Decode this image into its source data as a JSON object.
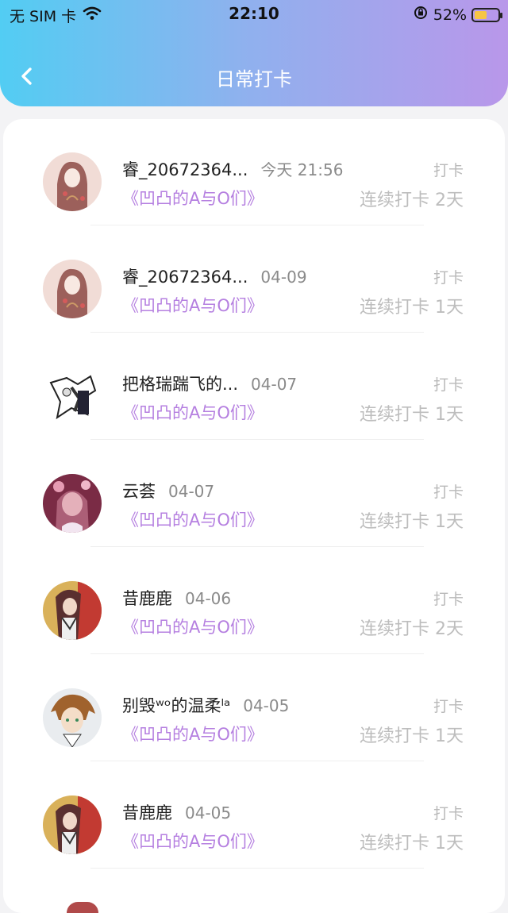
{
  "status_bar": {
    "carrier": "无 SIM 卡",
    "time": "22:10",
    "battery_percent": "52%",
    "battery_level": 0.52
  },
  "nav": {
    "title": "日常打卡",
    "back_icon": "chevron-left-icon"
  },
  "colors": {
    "header_gradient": [
      "#52cdf3",
      "#b997ea"
    ],
    "book_title": "#b57fe0",
    "muted": "#bdbdbd"
  },
  "entries": [
    {
      "name": "睿_20672364...",
      "date": "今天 21:56",
      "book": "《凹凸的A与O们》",
      "checkin": "打卡",
      "streak": "连续打卡 2天",
      "avatar": "girl-red-avatar"
    },
    {
      "name": "睿_20672364...",
      "date": "04-09",
      "book": "《凹凸的A与O们》",
      "checkin": "打卡",
      "streak": "连续打卡 1天",
      "avatar": "girl-red-avatar"
    },
    {
      "name": "把格瑞踹飞的...",
      "date": "04-07",
      "book": "《凹凸的A与O们》",
      "checkin": "打卡",
      "streak": "连续打卡 1天",
      "avatar": "sketch-avatar"
    },
    {
      "name": "云荟",
      "date": "04-07",
      "book": "《凹凸的A与O们》",
      "checkin": "打卡",
      "streak": "连续打卡 1天",
      "avatar": "flower-girl-avatar"
    },
    {
      "name": "昔鹿鹿",
      "date": "04-06",
      "book": "《凹凸的A与O们》",
      "checkin": "打卡",
      "streak": "连续打卡 2天",
      "avatar": "dark-hair-avatar"
    },
    {
      "name": "别毁ʷᵒ的温柔ˡᵃ",
      "date": "04-05",
      "book": "《凹凸的A与O们》",
      "checkin": "打卡",
      "streak": "连续打卡 1天",
      "avatar": "brown-hair-avatar"
    },
    {
      "name": "昔鹿鹿",
      "date": "04-05",
      "book": "《凹凸的A与O们》",
      "checkin": "打卡",
      "streak": "连续打卡 1天",
      "avatar": "dark-hair-avatar"
    }
  ]
}
